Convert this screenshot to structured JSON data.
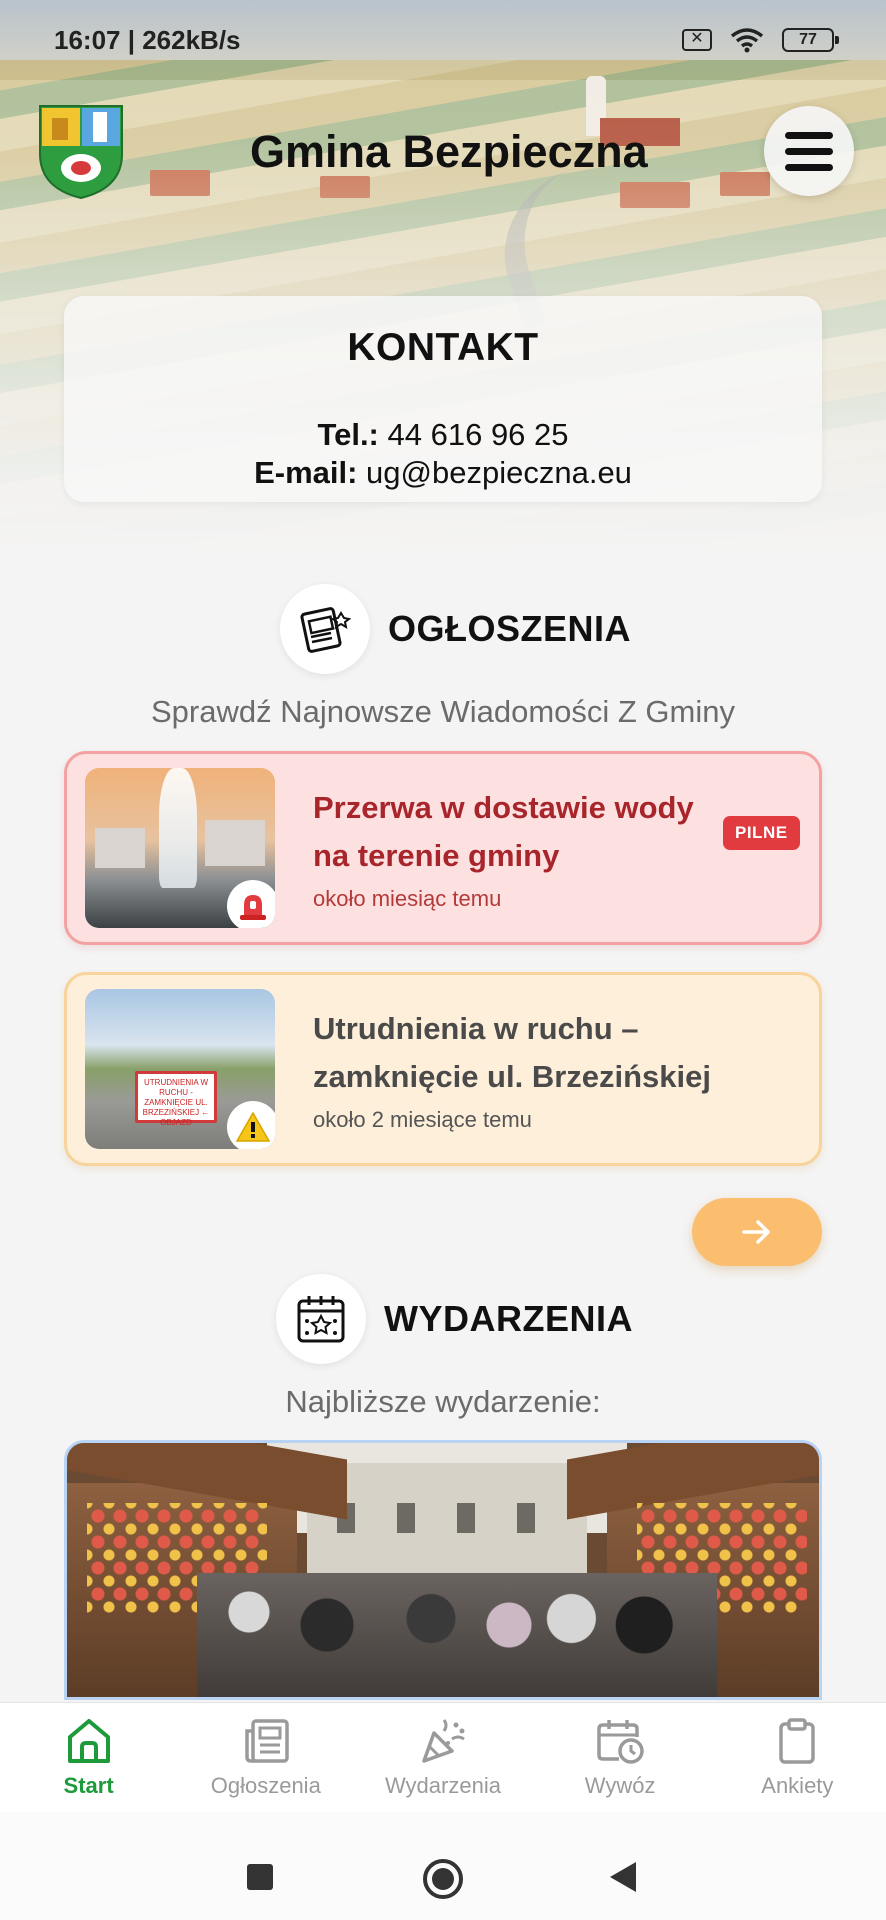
{
  "status_bar": {
    "time_speed": "16:07 | 262kB/s",
    "battery": "77",
    "sim_icon": "sim-disabled-icon",
    "wifi_icon": "wifi-icon"
  },
  "header": {
    "title": "Gmina Bezpieczna",
    "menu_icon": "hamburger-menu-icon"
  },
  "contact": {
    "title": "KONTAKT",
    "phone_label": "Tel.:",
    "phone_value": "44 616 96 25",
    "email_label": "E-mail:",
    "email_value": "ug@bezpieczna.eu"
  },
  "announcements": {
    "title": "OGŁOSZENIA",
    "subtitle": "Sprawdź Najnowsze Wiadomości Z Gminy",
    "items": [
      {
        "title": "Przerwa w dostawie wody na terenie gminy",
        "time": "około miesiąc temu",
        "badge": "PILNE",
        "icon": "siren-icon",
        "color": "#fde1e1"
      },
      {
        "title": "Utrudnienia w ruchu – zamknięcie ul. Brzezińskiej",
        "time": "około 2 miesiące temu",
        "icon": "warning-icon",
        "color": "#fdefd9"
      }
    ],
    "more_icon": "arrow-right-icon",
    "sign_text": "UTRUDNIENIA W RUCHU - ZAMKNIĘCIE UL. BRZEZIŃSKIEJ ← OBJAZD"
  },
  "events": {
    "title": "WYDARZENIA",
    "subtitle": "Najbliższe wydarzenie:"
  },
  "bottom_nav": {
    "items": [
      {
        "label": "Start",
        "icon": "home-icon",
        "active": true
      },
      {
        "label": "Ogłoszenia",
        "icon": "newspaper-icon",
        "active": false
      },
      {
        "label": "Wydarzenia",
        "icon": "party-popper-icon",
        "active": false
      },
      {
        "label": "Wywóz",
        "icon": "calendar-clock-icon",
        "active": false
      },
      {
        "label": "Ankiety",
        "icon": "clipboard-icon",
        "active": false
      }
    ]
  },
  "colors": {
    "accent_green": "#1d9a3a",
    "urgent_red": "#e13a3f",
    "more_button": "#fbbe6f"
  }
}
